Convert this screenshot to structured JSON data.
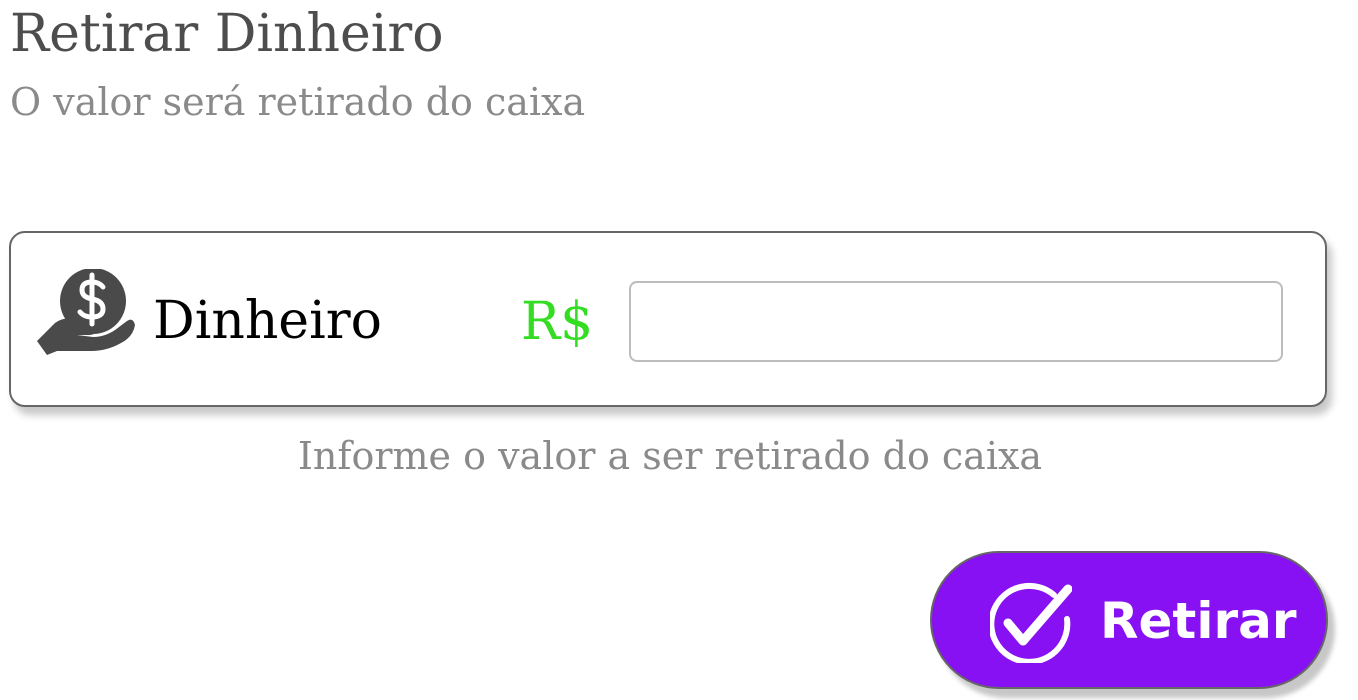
{
  "header": {
    "title": "Retirar Dinheiro",
    "subtitle": "O valor será retirado do caixa"
  },
  "payment_row": {
    "icon": "money-hand-icon",
    "label": "Dinheiro",
    "currency_symbol": "R$",
    "amount_value": "",
    "amount_placeholder": ""
  },
  "hint": "Informe o valor a ser retirado do caixa",
  "submit": {
    "icon": "check-circle-icon",
    "label": "Retirar"
  },
  "colors": {
    "accent": "#8711f2",
    "currency": "#33dd22",
    "title": "#4d4d4d",
    "muted": "#8a8a8a"
  }
}
